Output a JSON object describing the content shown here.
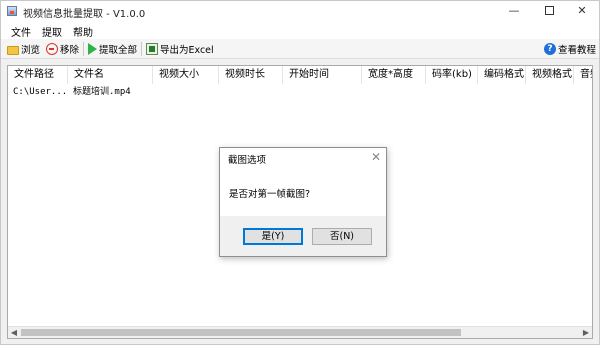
{
  "window": {
    "title": "视频信息批量提取 - V1.0.0",
    "minimize": "—",
    "close": "✕"
  },
  "menu": [
    "文件",
    "提取",
    "帮助"
  ],
  "toolbar": {
    "browse": "浏览",
    "remove": "移除",
    "extract_all": "提取全部",
    "export_excel": "导出为Excel",
    "tutorial": "查看教程",
    "help_glyph": "?"
  },
  "list": {
    "columns": [
      "文件路径",
      "文件名",
      "视频大小",
      "视频时长",
      "开始时间",
      "宽度*高度",
      "码率(kb)",
      "编码格式",
      "视频格式",
      "音频"
    ],
    "rows": [
      {
        "path": "C:\\User...",
        "name": "标题培训.mp4"
      }
    ]
  },
  "scrollbar": {
    "left_arrow": "◀",
    "right_arrow": "▶"
  },
  "dialog": {
    "title": "截图选项",
    "close": "✕",
    "message": "是否对第一帧截图?",
    "yes": "是(Y)",
    "no": "否(N)"
  }
}
